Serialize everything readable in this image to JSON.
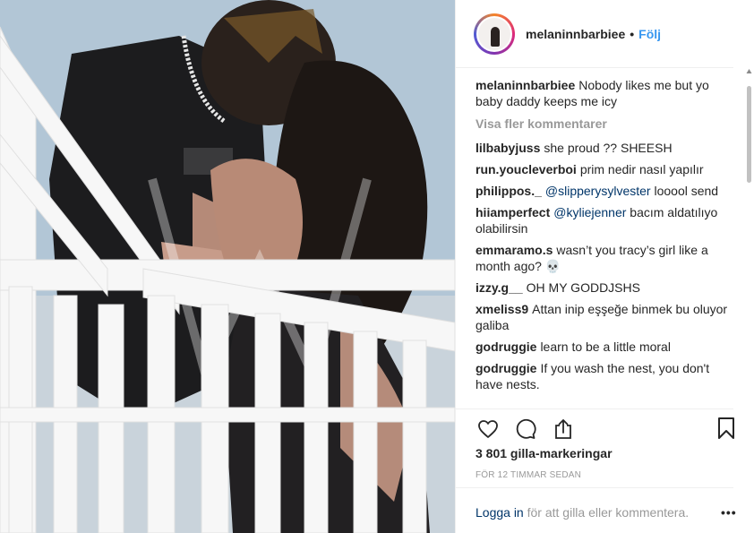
{
  "post": {
    "username": "melaninnbarbiee",
    "separator": "•",
    "follow_label": "Följ",
    "caption_user": "melaninnbarbiee",
    "caption_text": "Nobody likes me but yo baby daddy keeps me icy",
    "view_more_label": "Visa fler kommentarer",
    "comments": [
      {
        "user": "lilbabyjuss",
        "mention": "",
        "text": "she proud ?? SHEESH"
      },
      {
        "user": "run.youcleverboi",
        "mention": "",
        "text": "prim nedir nasıl yapılır"
      },
      {
        "user": "philippos._",
        "mention": "@slipperysylvester",
        "text": "looool send"
      },
      {
        "user": "hiiamperfect",
        "mention": "@kyliejenner",
        "text": "bacım aldatılıyo olabilirsin"
      },
      {
        "user": "emmaramo.s",
        "mention": "",
        "text": "wasn’t you tracy’s girl like a month ago? 💀"
      },
      {
        "user": "izzy.g__",
        "mention": "",
        "text": "OH MY GODDJSHS"
      },
      {
        "user": "xmeliss9",
        "mention": "",
        "text": "Attan inip eşşeğe binmek bu oluyor galiba"
      },
      {
        "user": "godruggie",
        "mention": "",
        "text": "learn to be a little moral"
      },
      {
        "user": "godruggie",
        "mention": "",
        "text": "If you wash the nest, you don't have nests."
      }
    ],
    "likes_label": "3 801 gilla-markeringar",
    "time_label": "FÖR 12 TIMMAR SEDAN",
    "login_link": "Logga in",
    "login_rest": " för att gilla eller kommentera.",
    "more_dots": "•••"
  },
  "icons": {
    "like": "heart-icon",
    "comment": "comment-bubble-icon",
    "share": "share-upload-icon",
    "save": "bookmark-icon",
    "more": "more-options-icon"
  },
  "colors": {
    "link_blue": "#3897f0",
    "mention_blue": "#003569",
    "muted": "#999999",
    "text": "#262626"
  }
}
